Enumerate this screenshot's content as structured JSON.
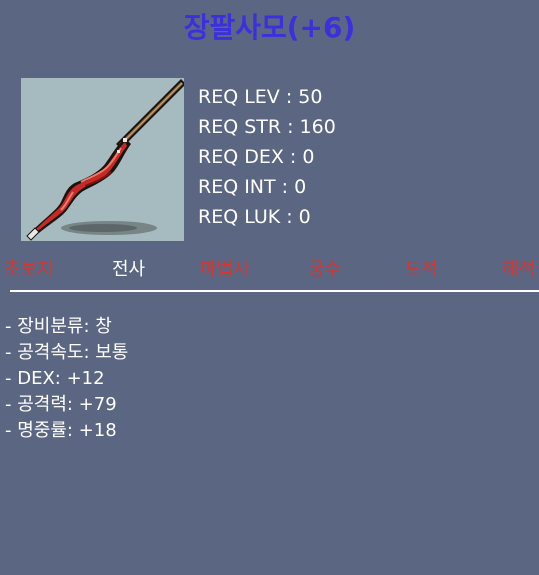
{
  "item": {
    "name": "장팔사모(+6)",
    "icon": "spear-icon"
  },
  "requirements": [
    "REQ LEV : 50",
    "REQ STR : 160",
    "REQ DEX : 0",
    "REQ INT : 0",
    "REQ LUK : 0"
  ],
  "jobs": [
    {
      "label": "초보자",
      "allowed": false
    },
    {
      "label": "전사",
      "allowed": true
    },
    {
      "label": "마법사",
      "allowed": false
    },
    {
      "label": "궁수",
      "allowed": false
    },
    {
      "label": "도적",
      "allowed": false
    },
    {
      "label": "해적",
      "allowed": false
    }
  ],
  "details": [
    "- 장비분류: 창",
    "- 공격속도: 보통",
    "- DEX: +12",
    "- 공격력: +79",
    "- 명중률: +18"
  ],
  "colors": {
    "background": "#5b6682",
    "title": "#3b2fe0",
    "job_disabled": "#d9342d",
    "job_enabled": "#ffffff",
    "icon_bg": "#a6bbbf"
  }
}
